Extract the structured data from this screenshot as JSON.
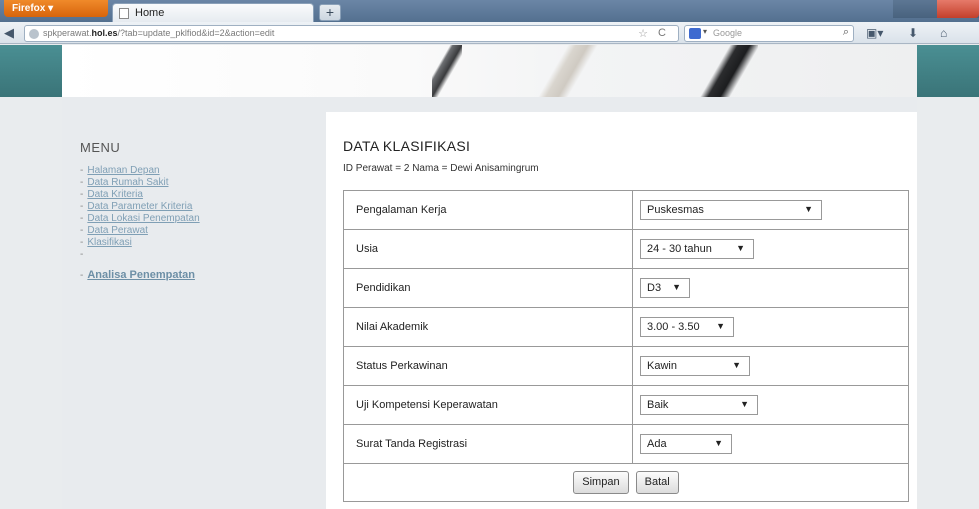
{
  "browser": {
    "menu_label": "Firefox",
    "tab_title": "Home",
    "new_tab": "+",
    "url_prefix": "spkperawat.",
    "url_domain": "hol.es",
    "url_rest": "/?tab=update_pklfiod&id=2&action=edit",
    "search_placeholder": "Google"
  },
  "menu": {
    "title": "MENU",
    "items": [
      {
        "label": "Halaman Depan"
      },
      {
        "label": "Data Rumah Sakit"
      },
      {
        "label": "Data Kriteria"
      },
      {
        "label": "Data Parameter Kriteria"
      },
      {
        "label": "Data Lokasi Penempatan"
      },
      {
        "label": "Data Perawat"
      },
      {
        "label": "Klasifikasi"
      },
      {
        "label": ""
      },
      {
        "label": "Analisa Penempatan"
      }
    ]
  },
  "main": {
    "title": "DATA KLASIFIKASI",
    "info": "ID Perawat = 2  Nama = Dewi Anisamingrum",
    "fields": [
      {
        "label": "Pengalaman Kerja",
        "value": "Puskesmas"
      },
      {
        "label": "Usia",
        "value": "24 - 30 tahun"
      },
      {
        "label": "Pendidikan",
        "value": "D3"
      },
      {
        "label": "Nilai Akademik",
        "value": "3.00 - 3.50"
      },
      {
        "label": "Status Perkawinan",
        "value": "Kawin"
      },
      {
        "label": "Uji Kompetensi Keperawatan",
        "value": "Baik"
      },
      {
        "label": "Surat Tanda Registrasi",
        "value": "Ada"
      }
    ],
    "save_label": "Simpan",
    "cancel_label": "Batal"
  }
}
